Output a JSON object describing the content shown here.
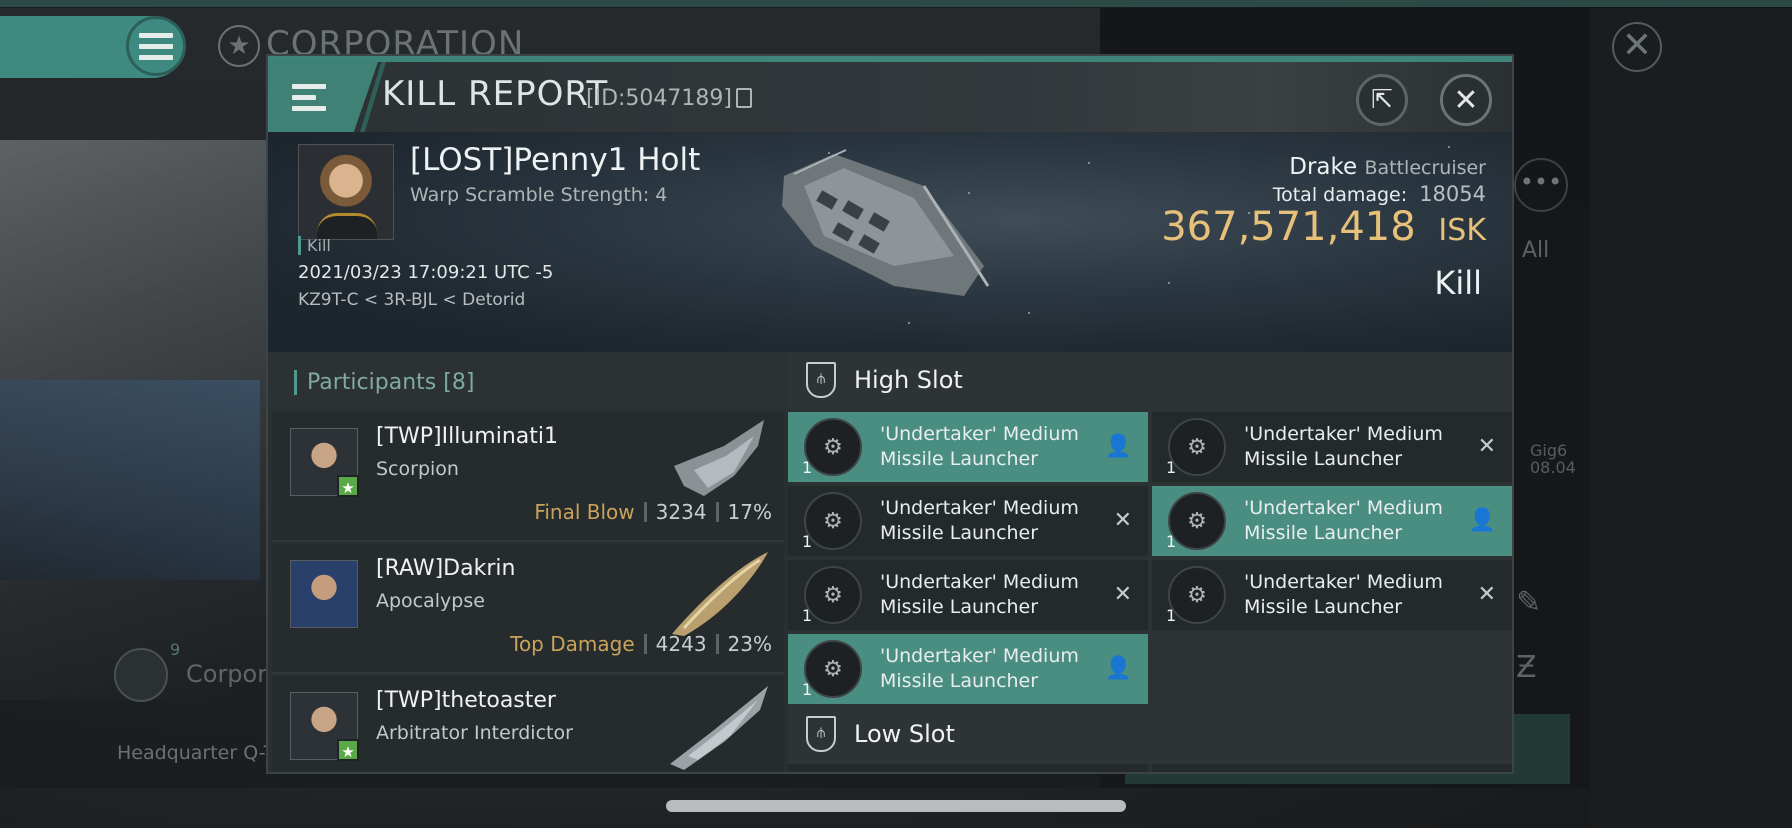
{
  "background": {
    "corp_title": "CORPORATION",
    "all_label": "All",
    "gig_label": "Gig6",
    "gig_date": "08.04",
    "corp_small_label": "Corpora",
    "corp_small_count": "9",
    "hq_label": "Headquarter Q-T"
  },
  "dialog": {
    "title": "KILL REPORT",
    "report_id": "[ID:5047189]",
    "victim": {
      "name": "[LOST]Penny1 Holt",
      "warp_scramble": "Warp Scramble Strength: 4",
      "tag": "Kill",
      "time": "2021/03/23 17:09:21 UTC -5",
      "location": "KZ9T-C < 3R-BJL < Detorid",
      "ship_name": "Drake",
      "ship_class": "Battlecruiser",
      "total_damage_label": "Total damage:",
      "total_damage": "18054",
      "isk_value": "367,571,418",
      "isk_unit": "ISK",
      "result": "Kill"
    },
    "participants": {
      "title": "Participants",
      "count": "[8]",
      "rows": [
        {
          "name": "[TWP]Illuminati1",
          "ship": "Scorpion",
          "label": "Final Blow",
          "damage": "3234",
          "percent": "17%"
        },
        {
          "name": "[RAW]Dakrin",
          "ship": "Apocalypse",
          "label": "Top Damage",
          "damage": "4243",
          "percent": "23%"
        },
        {
          "name": "[TWP]thetoaster",
          "ship": "Arbitrator Interdictor",
          "label": "",
          "damage": "",
          "percent": ""
        }
      ]
    },
    "high_slot": {
      "title": "High Slot",
      "modules": [
        {
          "name": "'Undertaker' Medium Missile Launcher",
          "qty": "1",
          "state": "person-icon"
        },
        {
          "name": "'Undertaker' Medium Missile Launcher",
          "qty": "1",
          "state": "x-icon"
        },
        {
          "name": "'Undertaker' Medium Missile Launcher",
          "qty": "1",
          "state": "x-icon"
        },
        {
          "name": "'Undertaker' Medium Missile Launcher",
          "qty": "1",
          "state": "person-icon"
        },
        {
          "name": "'Undertaker' Medium Missile Launcher",
          "qty": "1",
          "state": "x-icon"
        },
        {
          "name": "'Undertaker' Medium Missile Launcher",
          "qty": "1",
          "state": "x-icon"
        },
        {
          "name": "'Undertaker' Medium Missile Launcher",
          "qty": "1",
          "state": "person-icon"
        }
      ]
    },
    "low_slot": {
      "title": "Low Slot"
    }
  },
  "colors": {
    "accent": "#3f8a80",
    "isk": "#e7c07a",
    "final_blow": "#c9a35a",
    "module_active": "#4a8e82"
  }
}
